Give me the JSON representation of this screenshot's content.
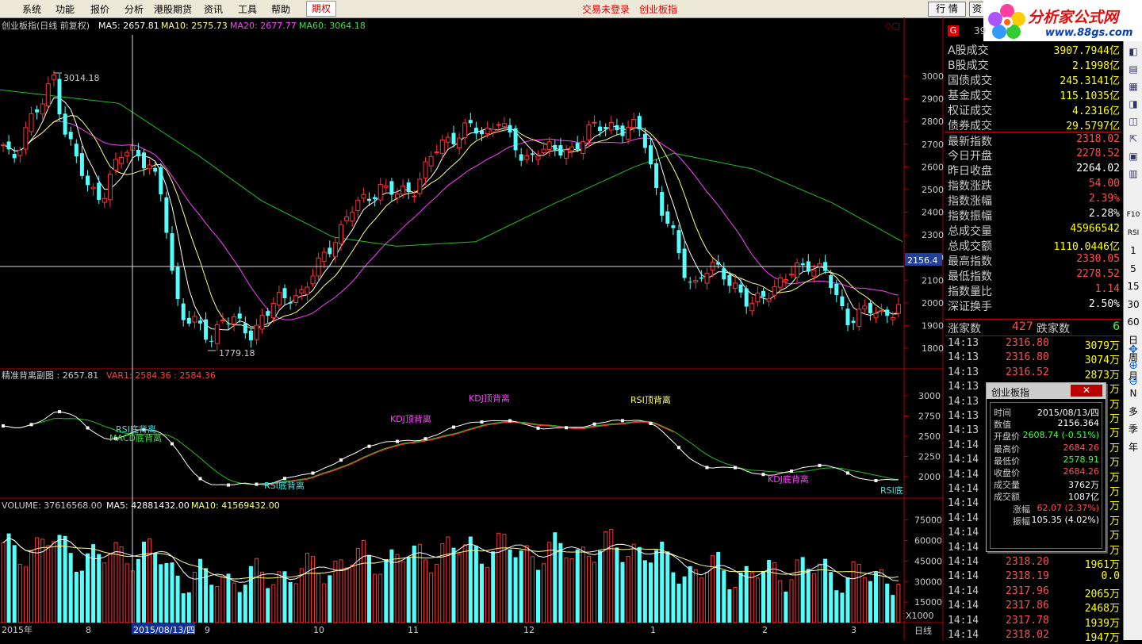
{
  "menubar": {
    "items": [
      "系统",
      "功能",
      "报价",
      "分析",
      "港股期货",
      "资讯",
      "工具",
      "帮助"
    ],
    "active": "期权",
    "status1": "交易未登录",
    "status2": "创业板指",
    "btn1": "行 情",
    "btn2": "资"
  },
  "logo": {
    "title": "分析家公式网",
    "url": "www.88gs.com",
    "ghost": "创业板"
  },
  "main_chart": {
    "header": {
      "name": "创业板指(日线 前复权)",
      "ma5": "MA5: 2657.81",
      "ma10": "MA10: 2575.73",
      "ma20": "MA20: 2677.77",
      "ma60": "MA60: 3064.18"
    },
    "hi_label": "3014.18",
    "lo_label": "1779.18",
    "crosshair_price": "2156.4",
    "y_ticks": [
      "3000",
      "2900",
      "2800",
      "2700",
      "2600",
      "2500",
      "2400",
      "2300",
      "2200",
      "2100",
      "2000",
      "1900",
      "1800"
    ],
    "colors": {
      "up": "#ff3232",
      "down": "#54ffff",
      "ma5": "#ffffff",
      "ma10": "#ffff80",
      "ma20": "#ff40ff",
      "ma60": "#20c020"
    }
  },
  "sub_chart": {
    "header": {
      "name": "精准背离副图 : 2657.81",
      "var1": "VAR1: 2584.36 : 2584.36"
    },
    "y_ticks": [
      "3000",
      "2750",
      "2500",
      "2250",
      "2000"
    ],
    "signals": [
      "RSI底背离",
      "MACD底背离",
      "KDJ顶背离",
      "KDJ顶背离",
      "RSI顶背离",
      "RSI底背离",
      "KDJ底背离",
      "RSI底"
    ]
  },
  "volume_chart": {
    "header": {
      "name": "VOLUME: 37616568.00",
      "ma5": "MA5: 42881432.00",
      "ma10": "MA10: 41569432.00"
    },
    "y_ticks": [
      "75000",
      "60000",
      "45000",
      "30000",
      "15000"
    ],
    "unit": "X1000"
  },
  "x_axis": {
    "labels": [
      "2015年",
      "8",
      "9",
      "10",
      "11",
      "12",
      "1",
      "2",
      "3"
    ],
    "cursor_date": "2015/08/13/四",
    "period": "日线"
  },
  "right_panel": {
    "code_badge": "G",
    "code": "39",
    "quotes": [
      {
        "label": "A股成交",
        "value": "3907.7944亿",
        "color": "#ffff00"
      },
      {
        "label": "B股成交",
        "value": "2.1998亿",
        "color": "#ffff00"
      },
      {
        "label": "国债成交",
        "value": "245.3141亿",
        "color": "#ffff00"
      },
      {
        "label": "基金成交",
        "value": "115.1035亿",
        "color": "#ffff00"
      },
      {
        "label": "权证成交",
        "value": "4.2316亿",
        "color": "#ffff00"
      },
      {
        "label": "债券成交",
        "value": "29.5797亿",
        "color": "#ffff00"
      },
      {
        "label": "最新指数",
        "value": "2318.02",
        "color": "#ff5050"
      },
      {
        "label": "今日开盘",
        "value": "2278.52",
        "color": "#ff5050"
      },
      {
        "label": "昨日收盘",
        "value": "2264.02",
        "color": "#ffffff"
      },
      {
        "label": "指数涨跌",
        "value": "54.00",
        "color": "#ff5050"
      },
      {
        "label": "指数涨幅",
        "value": "2.39%",
        "color": "#ff5050"
      },
      {
        "label": "指数振幅",
        "value": "2.28%",
        "color": "#ffffff"
      },
      {
        "label": "总成交量",
        "value": "45966542",
        "color": "#ffff00"
      },
      {
        "label": "总成交额",
        "value": "1110.0446亿",
        "color": "#ffff00"
      },
      {
        "label": "最高指数",
        "value": "2330.05",
        "color": "#ff5050"
      },
      {
        "label": "最低指数",
        "value": "2278.52",
        "color": "#ff5050"
      },
      {
        "label": "指数量比",
        "value": "1.14",
        "color": "#ff5050"
      },
      {
        "label": "深证换手",
        "value": "2.50%",
        "color": "#ffffff"
      }
    ],
    "breadth": {
      "up_label": "涨家数",
      "up_value": "427",
      "down_label": "跌家数",
      "down_value": "6"
    },
    "ticks": [
      {
        "time": "14:13",
        "price": "2316.80",
        "vol": "3079万"
      },
      {
        "time": "14:13",
        "price": "2316.80",
        "vol": "3074万"
      },
      {
        "time": "14:13",
        "price": "2316.52",
        "vol": "2873万"
      },
      {
        "time": "14:13",
        "price": "",
        "vol": "万"
      },
      {
        "time": "14:13",
        "price": "",
        "vol": "万"
      },
      {
        "time": "14:13",
        "price": "",
        "vol": "万"
      },
      {
        "time": "14:13",
        "price": "",
        "vol": "万"
      },
      {
        "time": "14:14",
        "price": "",
        "vol": "万"
      },
      {
        "time": "14:14",
        "price": "",
        "vol": "万"
      },
      {
        "time": "14:14",
        "price": "",
        "vol": "万"
      },
      {
        "time": "14:14",
        "price": "",
        "vol": "万"
      },
      {
        "time": "14:14",
        "price": "",
        "vol": "万"
      },
      {
        "time": "14:14",
        "price": "",
        "vol": "万"
      },
      {
        "time": "14:14",
        "price": "",
        "vol": "万"
      },
      {
        "time": "14:14",
        "price": "",
        "vol": "万"
      },
      {
        "time": "14:14",
        "price": "2318.20",
        "vol": "1961万"
      },
      {
        "time": "14:14",
        "price": "2318.19",
        "vol": "0.0"
      },
      {
        "time": "14:14",
        "price": "2317.96",
        "vol": "2065万"
      },
      {
        "time": "14:14",
        "price": "2317.86",
        "vol": "2468万"
      },
      {
        "time": "14:14",
        "price": "2317.78",
        "vol": "1939万"
      },
      {
        "time": "14:14",
        "price": "2318.02",
        "vol": "1947万"
      }
    ]
  },
  "side_toolbar": [
    "F10",
    "RSI",
    "1",
    "5",
    "15",
    "30",
    "60",
    "日",
    "周",
    "月",
    "N",
    "多",
    "季",
    "年"
  ],
  "popup": {
    "title": "创业板指",
    "close": "✕",
    "rows": [
      {
        "label": "时间",
        "value": "2015/08/13/四",
        "color": "#ffffff"
      },
      {
        "label": "数值",
        "value": "2156.364",
        "color": "#ffffff"
      },
      {
        "label": "开盘价",
        "value": "2608.74 (-0.51%)",
        "color": "#40ff40"
      },
      {
        "label": "最高价",
        "value": "2684.26",
        "color": "#ff5050"
      },
      {
        "label": "最低价",
        "value": "2578.91",
        "color": "#40ff40"
      },
      {
        "label": "收盘价",
        "value": "2684.26",
        "color": "#ff5050"
      },
      {
        "label": "成交量",
        "value": "3762万",
        "color": "#ffffff"
      },
      {
        "label": "成交额",
        "value": "1087亿",
        "color": "#ffffff"
      },
      {
        "label": "涨幅",
        "value": "62.07 (2.37%)",
        "color": "#ff5050"
      },
      {
        "label": "振幅",
        "value": "105.35 (4.02%)",
        "color": "#ffffff"
      }
    ]
  }
}
